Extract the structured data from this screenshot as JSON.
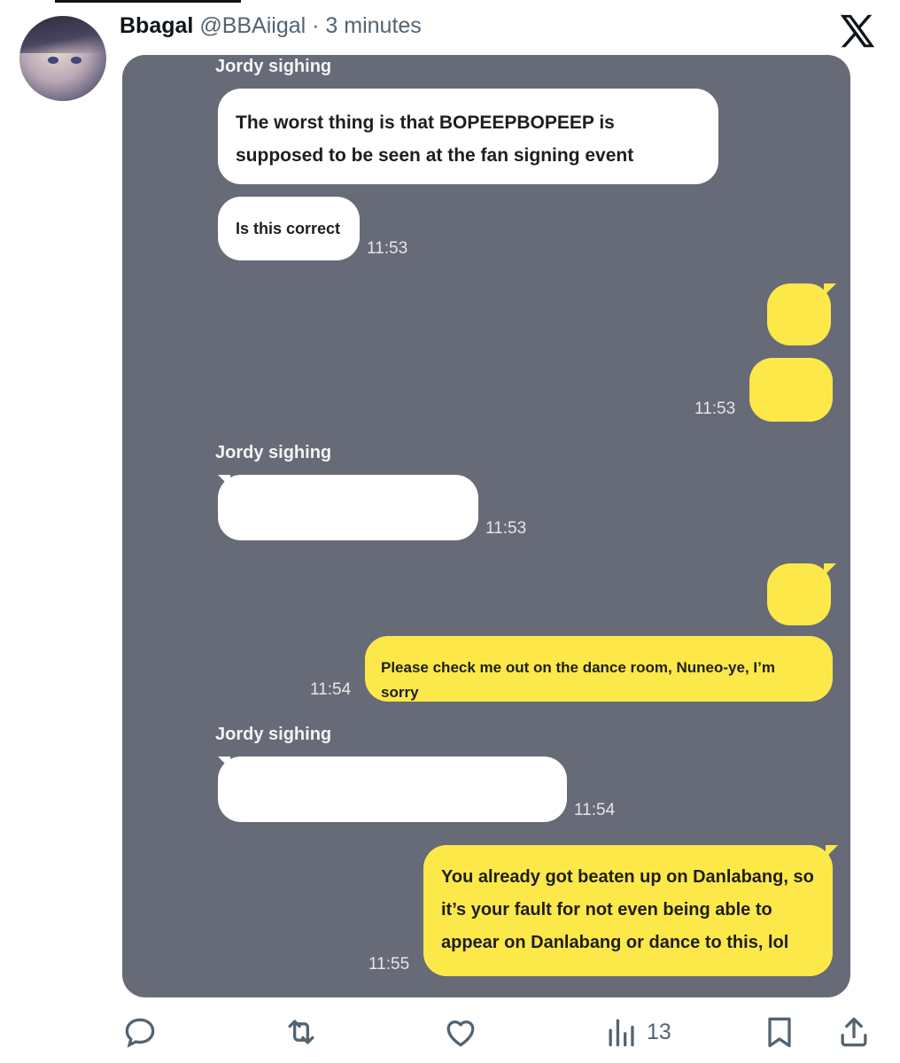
{
  "post": {
    "author_name": "Bbagal",
    "author_handle": "@BBAiigal",
    "separator": "·",
    "time_ago": "3 minutes"
  },
  "chat": {
    "sender_name": "Jordy sighing",
    "messages": [
      {
        "text": "The worst thing is that BOPEEPBOPEEP is supposed to be seen at the fan signing event",
        "time": ""
      },
      {
        "text": "Is this correct",
        "time": "11:53"
      },
      {
        "text": "",
        "time": "11:53"
      },
      {
        "text": "",
        "time": "11:53"
      },
      {
        "text": "Please check me out on the dance room, Nuneo-ye, I’m sorry",
        "time": "11:54"
      },
      {
        "text": "",
        "time": "11:54"
      },
      {
        "text": "You already got beaten up on Danlabang, so it’s your fault for not even being able to appear on Danlabang or dance to this, lol",
        "time": "11:55"
      }
    ]
  },
  "actions": {
    "reply_icon": "speech-bubble-icon",
    "repost_icon": "repost-icon",
    "like_icon": "heart-icon",
    "views_icon": "bar-chart-icon",
    "views_count": "13",
    "bookmark_icon": "bookmark-icon",
    "share_icon": "share-icon"
  },
  "colors": {
    "chat_background": "#666b77",
    "received_bubble": "#ffffff",
    "sent_bubble": "#fde84a"
  }
}
